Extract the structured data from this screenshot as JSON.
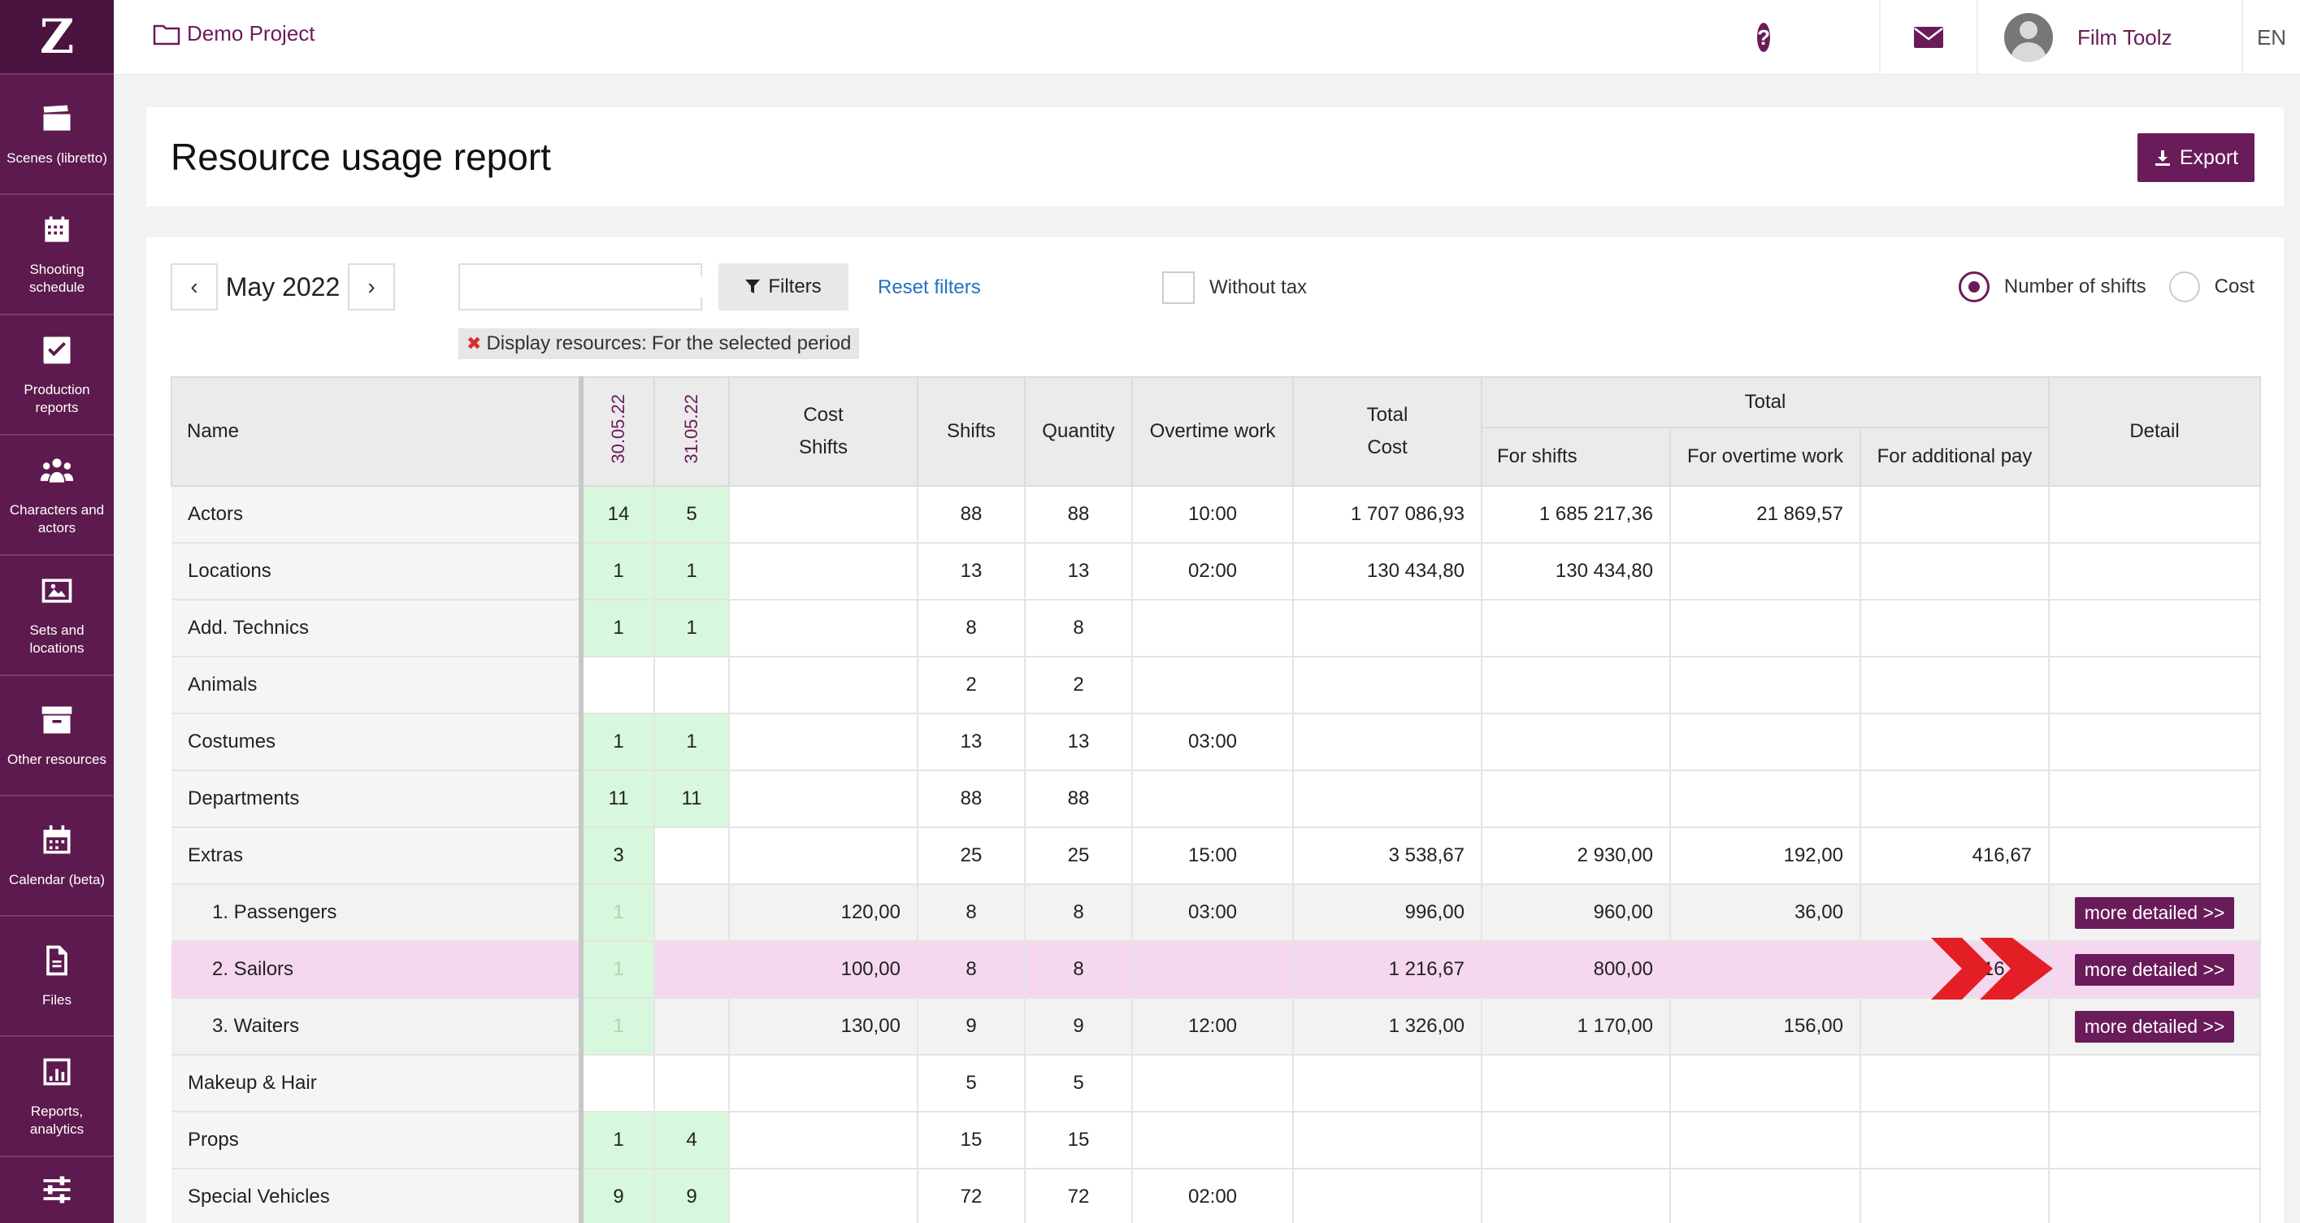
{
  "sidebar": {
    "logo": "Z",
    "items": [
      {
        "label": "Scenes (libretto)",
        "icon": "clapperboard-icon"
      },
      {
        "label": "Shooting schedule",
        "icon": "calendar-grid-icon"
      },
      {
        "label": "Production reports",
        "icon": "checkbox-icon"
      },
      {
        "label": "Characters and actors",
        "icon": "people-icon"
      },
      {
        "label": "Sets and locations",
        "icon": "image-icon"
      },
      {
        "label": "Other resources",
        "icon": "archive-box-icon"
      },
      {
        "label": "Calendar (beta)",
        "icon": "calendar-icon"
      },
      {
        "label": "Files",
        "icon": "file-icon"
      },
      {
        "label": "Reports, analytics",
        "icon": "bar-chart-icon"
      },
      {
        "label": "",
        "icon": "sliders-icon"
      }
    ]
  },
  "topbar": {
    "project": "Demo Project",
    "user": "Film Toolz",
    "lang": "EN"
  },
  "header": {
    "title": "Resource usage report",
    "export_label": "Export"
  },
  "toolbar": {
    "month": "May 2022",
    "prev": "‹",
    "next": "›",
    "search_value": "",
    "filters_label": "Filters",
    "reset_label": "Reset filters",
    "without_tax_label": "Without tax",
    "without_tax_checked": false,
    "radio_shifts_label": "Number of shifts",
    "radio_cost_label": "Cost",
    "selected_mode": "Number of shifts"
  },
  "chip": {
    "label": "Display resources:",
    "value": "For the selected period"
  },
  "table": {
    "headers": {
      "name": "Name",
      "date1": "30.05.22",
      "date2": "31.05.22",
      "cost_shifts_1": "Cost",
      "cost_shifts_2": "Shifts",
      "shifts": "Shifts",
      "quantity": "Quantity",
      "overtime": "Overtime work",
      "total_cost_1": "Total",
      "total_cost_2": "Cost",
      "total_group": "Total",
      "for_shifts": "For shifts",
      "for_overtime": "For overtime work",
      "for_additional": "For additional pay",
      "detail": "Detail"
    },
    "rows": [
      {
        "name": "Actors",
        "d1": "14",
        "d2": "5",
        "cost": "",
        "shifts": "88",
        "qty": "88",
        "overtime": "10:00",
        "total": "1 707 086,93",
        "for_shifts": "1 685 217,36",
        "for_overtime": "21 869,57",
        "for_additional": "",
        "detail": ""
      },
      {
        "name": "Locations",
        "d1": "1",
        "d2": "1",
        "cost": "",
        "shifts": "13",
        "qty": "13",
        "overtime": "02:00",
        "total": "130 434,80",
        "for_shifts": "130 434,80",
        "for_overtime": "",
        "for_additional": "",
        "detail": ""
      },
      {
        "name": "Add. Technics",
        "d1": "1",
        "d2": "1",
        "cost": "",
        "shifts": "8",
        "qty": "8",
        "overtime": "",
        "total": "",
        "for_shifts": "",
        "for_overtime": "",
        "for_additional": "",
        "detail": ""
      },
      {
        "name": "Animals",
        "d1": "",
        "d2": "",
        "cost": "",
        "shifts": "2",
        "qty": "2",
        "overtime": "",
        "total": "",
        "for_shifts": "",
        "for_overtime": "",
        "for_additional": "",
        "detail": ""
      },
      {
        "name": "Costumes",
        "d1": "1",
        "d2": "1",
        "cost": "",
        "shifts": "13",
        "qty": "13",
        "overtime": "03:00",
        "total": "",
        "for_shifts": "",
        "for_overtime": "",
        "for_additional": "",
        "detail": ""
      },
      {
        "name": "Departments",
        "d1": "11",
        "d2": "11",
        "cost": "",
        "shifts": "88",
        "qty": "88",
        "overtime": "",
        "total": "",
        "for_shifts": "",
        "for_overtime": "",
        "for_additional": "",
        "detail": ""
      },
      {
        "name": "Extras",
        "d1": "3",
        "d2": "",
        "cost": "",
        "shifts": "25",
        "qty": "25",
        "overtime": "15:00",
        "total": "3 538,67",
        "for_shifts": "2 930,00",
        "for_overtime": "192,00",
        "for_additional": "416,67",
        "detail": ""
      },
      {
        "name": "1. Passengers",
        "d1": "1",
        "d2": "",
        "cost": "120,00",
        "shifts": "8",
        "qty": "8",
        "overtime": "03:00",
        "total": "996,00",
        "for_shifts": "960,00",
        "for_overtime": "36,00",
        "for_additional": "",
        "detail": "more detailed >>"
      },
      {
        "name": "2. Sailors",
        "d1": "1",
        "d2": "",
        "cost": "100,00",
        "shifts": "8",
        "qty": "8",
        "overtime": "",
        "total": "1 216,67",
        "for_shifts": "800,00",
        "for_overtime": "",
        "for_additional": "416,67",
        "detail": "more detailed >>"
      },
      {
        "name": "3. Waiters",
        "d1": "1",
        "d2": "",
        "cost": "130,00",
        "shifts": "9",
        "qty": "9",
        "overtime": "12:00",
        "total": "1 326,00",
        "for_shifts": "1 170,00",
        "for_overtime": "156,00",
        "for_additional": "",
        "detail": "more detailed >>"
      },
      {
        "name": "Makeup & Hair",
        "d1": "",
        "d2": "",
        "cost": "",
        "shifts": "5",
        "qty": "5",
        "overtime": "",
        "total": "",
        "for_shifts": "",
        "for_overtime": "",
        "for_additional": "",
        "detail": ""
      },
      {
        "name": "Props",
        "d1": "1",
        "d2": "4",
        "cost": "",
        "shifts": "15",
        "qty": "15",
        "overtime": "",
        "total": "",
        "for_shifts": "",
        "for_overtime": "",
        "for_additional": "",
        "detail": ""
      },
      {
        "name": "Special Vehicles",
        "d1": "9",
        "d2": "9",
        "cost": "",
        "shifts": "72",
        "qty": "72",
        "overtime": "02:00",
        "total": "",
        "for_shifts": "",
        "for_overtime": "",
        "for_additional": "",
        "detail": ""
      }
    ]
  },
  "colors": {
    "brand": "#6a1b5a",
    "sidebar": "#5d1a4e",
    "green_cell": "#d8f8dd",
    "highlight_row": "#f6d7f0",
    "link": "#2272c3",
    "arrow": "#e31e24"
  }
}
